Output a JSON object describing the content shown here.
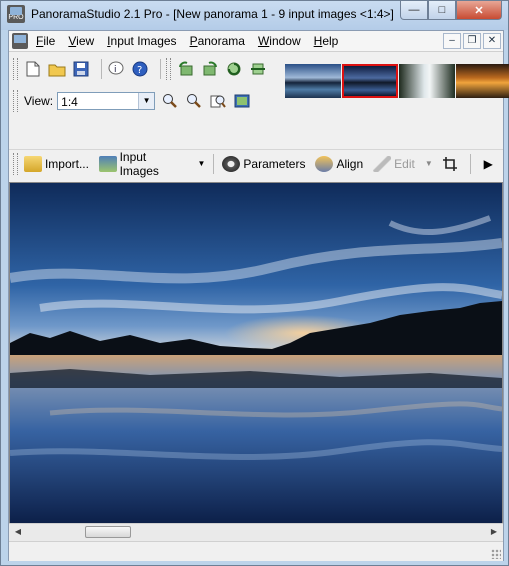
{
  "window": {
    "title": "PanoramaStudio 2.1 Pro - [New panorama 1 - 9 input images <1:4>]",
    "app_icon_text": "PRO"
  },
  "menu": {
    "items": [
      {
        "accel": "F",
        "rest": "ile"
      },
      {
        "accel": "V",
        "rest": "iew"
      },
      {
        "accel": "I",
        "rest": "nput Images"
      },
      {
        "accel": "P",
        "rest": "anorama"
      },
      {
        "accel": "W",
        "rest": "indow"
      },
      {
        "accel": "H",
        "rest": "elp"
      }
    ]
  },
  "view": {
    "label": "View:",
    "value": "1:4"
  },
  "mainbar": {
    "import_label": "Import...",
    "input_images_label": "Input Images",
    "parameters_label": "Parameters",
    "align_label": "Align",
    "edit_label": "Edit"
  },
  "colors": {
    "accent_selected_thumb": "#dd1111",
    "titlebar": "#c4d7ee"
  },
  "thumbnails": {
    "count": 4,
    "selected_index": 1
  }
}
